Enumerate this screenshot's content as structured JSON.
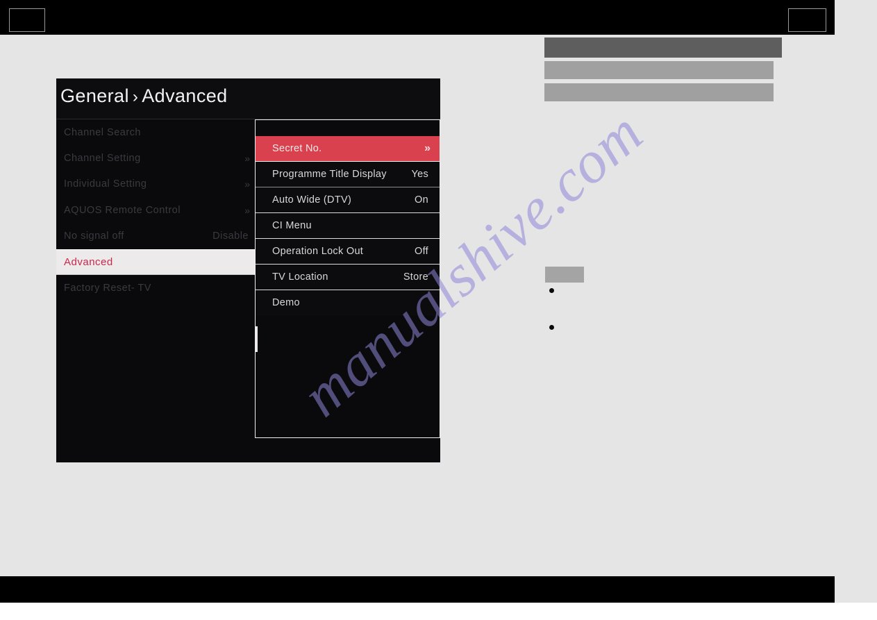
{
  "page": {
    "background_color": "#e5e5e5",
    "watermark": "manualshive.com",
    "watermark_color": "#8e86d8"
  },
  "header_band": {
    "background_color": "#000000",
    "left_box_label": "",
    "right_box_label": ""
  },
  "footer_band": {
    "background_color": "#000000"
  },
  "right_column": {
    "redacted_bars": [
      {
        "name": "bar-dark",
        "color": "#5e5e5e"
      },
      {
        "name": "bar-light-1",
        "color": "#a0a0a0"
      },
      {
        "name": "bar-light-2",
        "color": "#a0a0a0"
      },
      {
        "name": "bar-small",
        "color": "#a4a4a4"
      }
    ],
    "bullets": [
      {
        "marker": "•",
        "text": ""
      },
      {
        "marker": "•",
        "text": ""
      }
    ]
  },
  "osd": {
    "breadcrumb": {
      "root": "General",
      "separator": "›",
      "current": "Advanced"
    },
    "accent_color": "#d9414e",
    "left_menu": {
      "items": [
        {
          "label": "Channel Search",
          "value": "",
          "arrow": "",
          "selected": false
        },
        {
          "label": "Channel Setting",
          "value": "",
          "arrow": "»",
          "selected": false
        },
        {
          "label": "Individual Setting",
          "value": "",
          "arrow": "»",
          "selected": false
        },
        {
          "label": "AQUOS Remote Control",
          "value": "",
          "arrow": "»",
          "selected": false
        },
        {
          "label": "No signal off",
          "value": "Disable",
          "arrow": "",
          "selected": false
        },
        {
          "label": "Advanced",
          "value": "",
          "arrow": "",
          "selected": true
        },
        {
          "label": "Factory Reset- TV",
          "value": "",
          "arrow": "",
          "selected": false
        }
      ]
    },
    "submenu": {
      "items": [
        {
          "label": "Secret No.",
          "value": "",
          "arrow": "»",
          "selected": true
        },
        {
          "label": "Programme Title Display",
          "value": "Yes",
          "arrow": "",
          "selected": false
        },
        {
          "label": "Auto Wide (DTV)",
          "value": "On",
          "arrow": "",
          "selected": false
        },
        {
          "label": "CI Menu",
          "value": "",
          "arrow": "",
          "selected": false
        },
        {
          "label": "Operation Lock Out",
          "value": "Off",
          "arrow": "",
          "selected": false
        },
        {
          "label": "TV Location",
          "value": "Store",
          "arrow": "",
          "selected": false
        },
        {
          "label": "Demo",
          "value": "",
          "arrow": "",
          "selected": false
        }
      ]
    }
  }
}
